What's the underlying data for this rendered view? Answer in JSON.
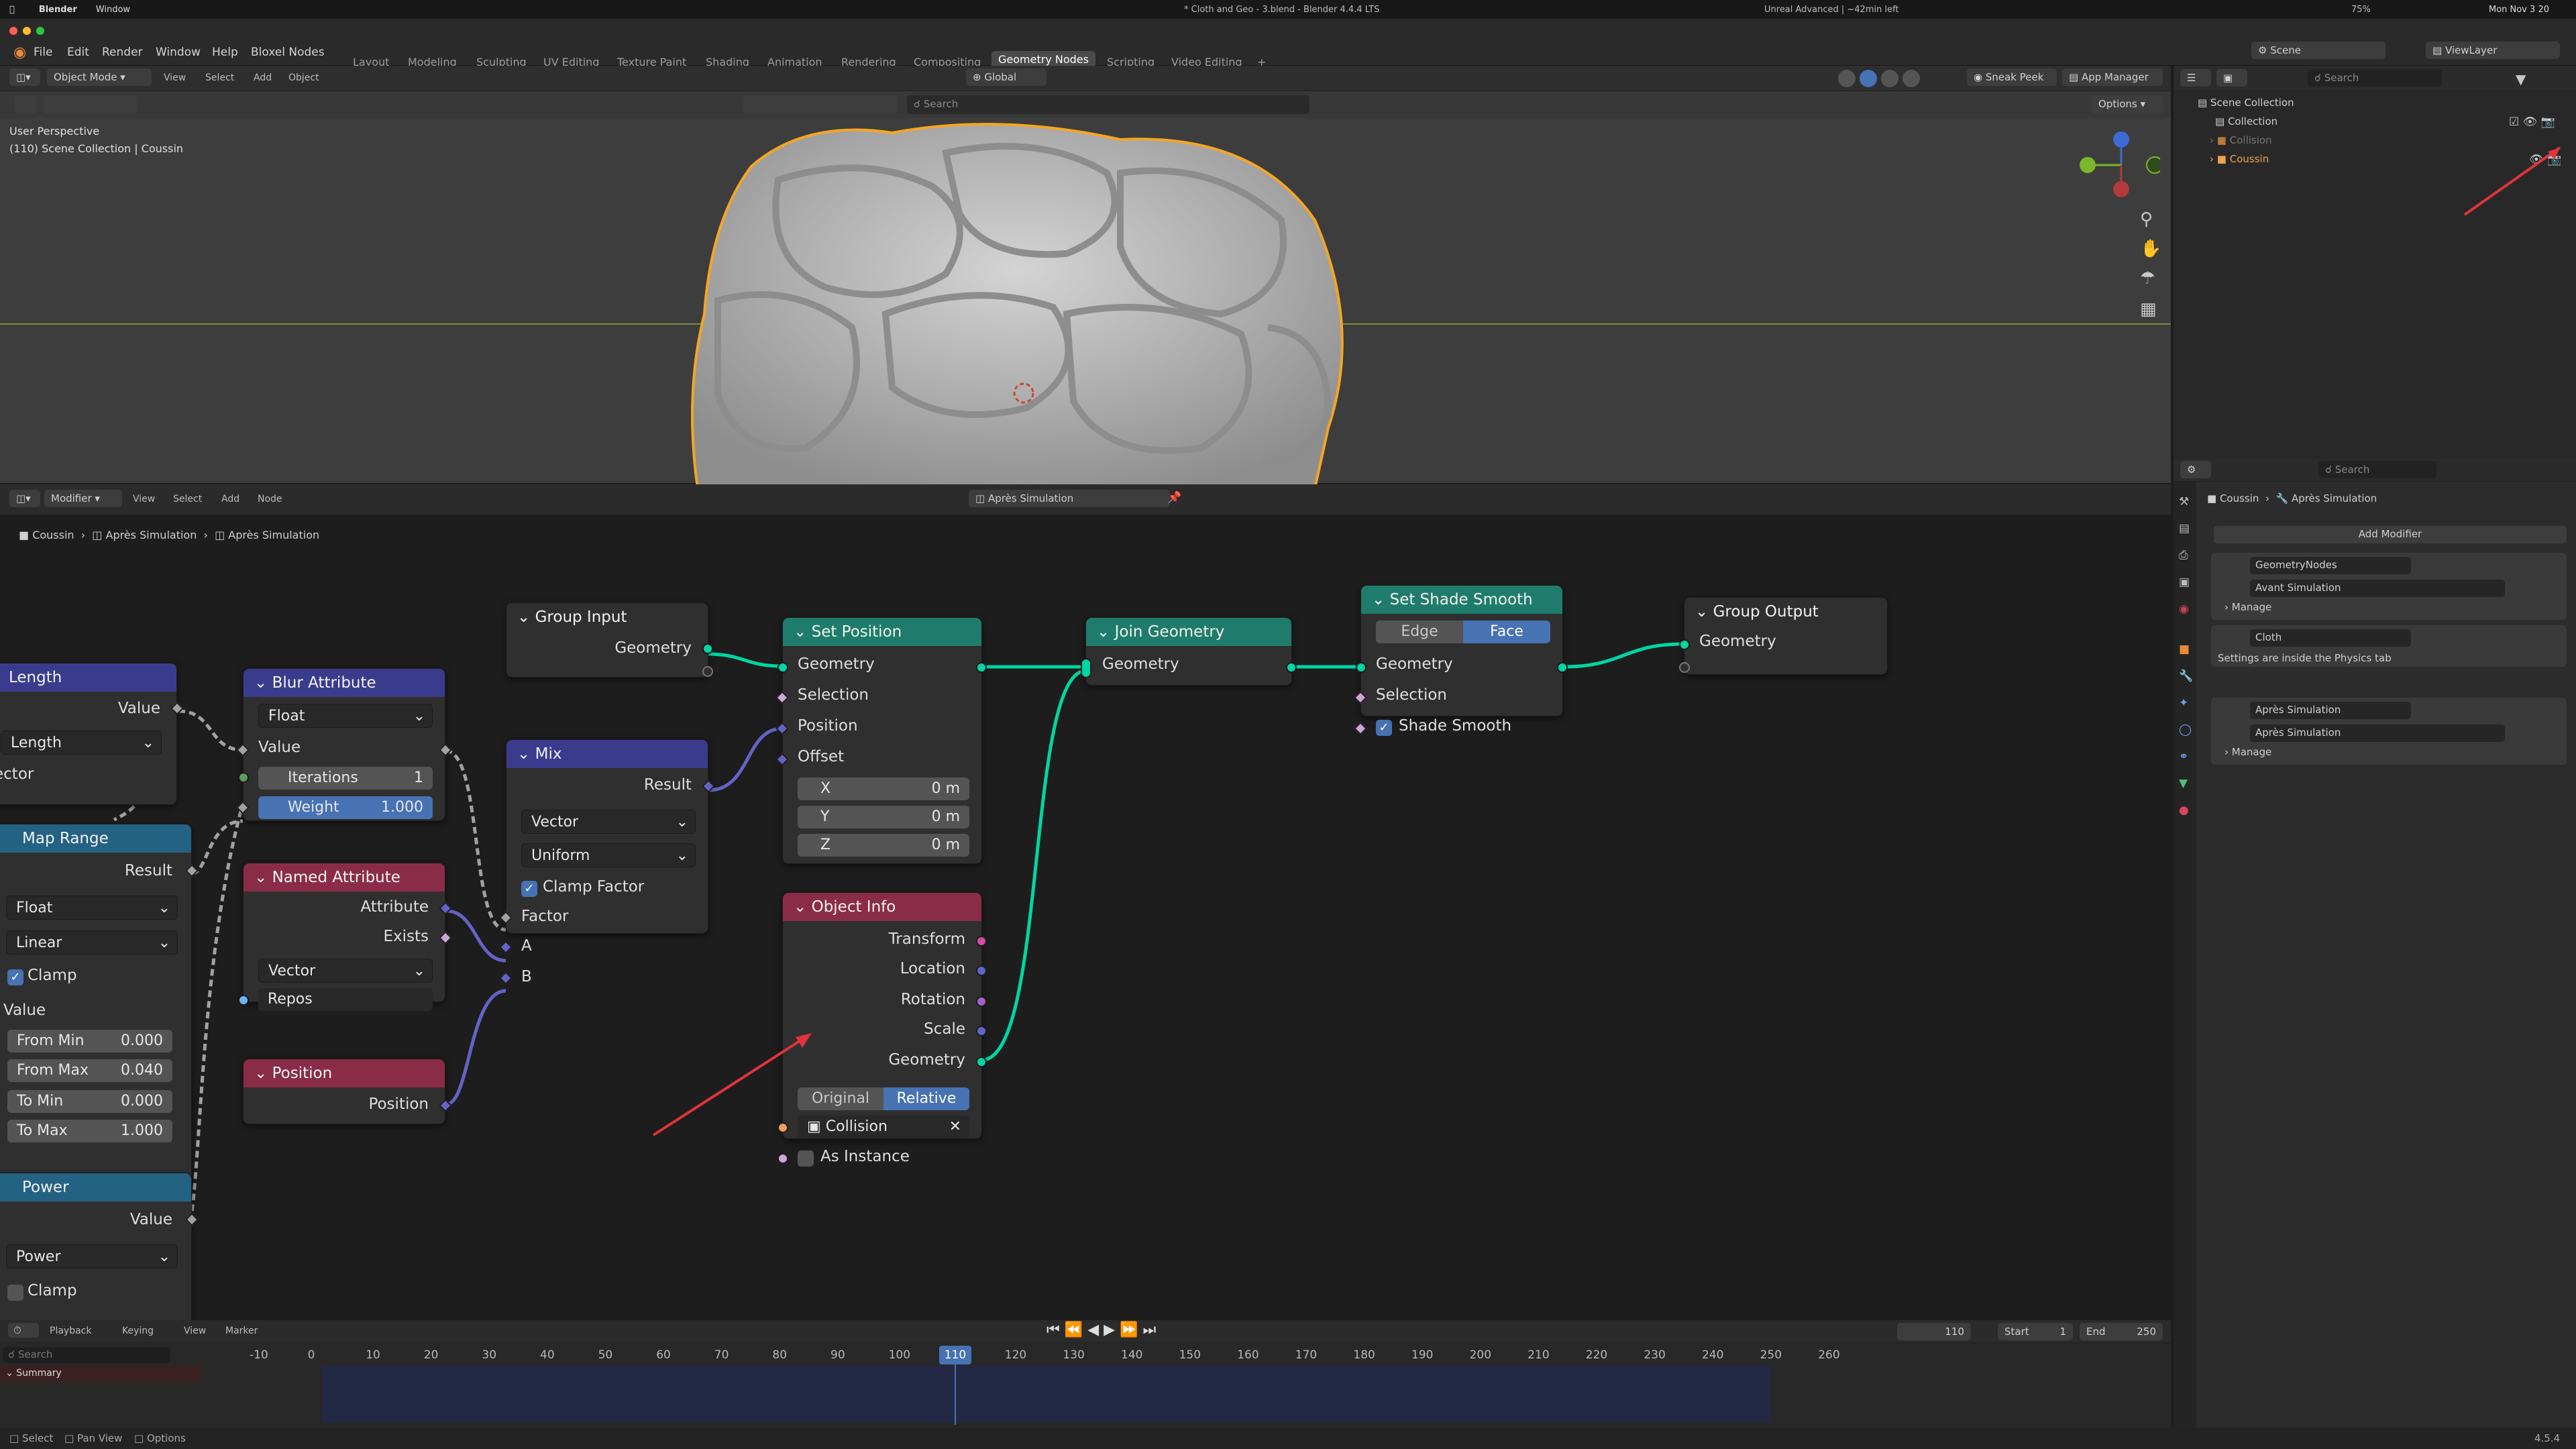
{
  "mac_menu": {
    "app": "Blender",
    "window": "Window",
    "doc_title": "* Cloth and Geo - 3.blend - Blender 4.4.4 LTS",
    "status": "Unreal Advanced | ~42min left",
    "battery": "75%",
    "clock": "Mon Nov 3  20"
  },
  "menu": [
    "File",
    "Edit",
    "Render",
    "Window",
    "Help",
    "Bloxel Nodes"
  ],
  "workspaces": [
    "Layout",
    "Modeling",
    "Sculpting",
    "UV Editing",
    "Texture Paint",
    "Shading",
    "Animation",
    "Rendering",
    "Compositing",
    "Geometry Nodes",
    "Scripting",
    "Video Editing",
    "+"
  ],
  "scene": {
    "scene_label": "Scene",
    "view_layer": "ViewLayer"
  },
  "viewport": {
    "mode": "Object Mode",
    "menus": [
      "View",
      "Select",
      "Add",
      "Object"
    ],
    "orientation": "Global",
    "search_placeholder": "Search",
    "perspective": "User Perspective",
    "collection_info": "(110) Scene Collection | Coussin",
    "sneak_peek": "Sneak Peek",
    "app_manager": "App Manager",
    "options": "Options"
  },
  "outliner": {
    "search_placeholder": "Search",
    "items": [
      "Scene Collection",
      "Collection",
      "Collision",
      "Coussin"
    ]
  },
  "node_editor": {
    "editor": "Modifier",
    "menus": [
      "View",
      "Select",
      "Add",
      "Node"
    ],
    "tree_name": "Après Simulation",
    "breadcrumb": [
      "Coussin",
      "Après Simulation",
      "Après Simulation"
    ]
  },
  "nodes": {
    "length": {
      "title": "Length",
      "value": "Value",
      "dropdown": "Length",
      "socket": "ector"
    },
    "map_range": {
      "title": "Map Range",
      "result": "Result",
      "data_type": "Float",
      "interp": "Linear",
      "clamp": "Clamp",
      "value": "Value",
      "from_min_l": "From Min",
      "from_min": "0.000",
      "from_max_l": "From Max",
      "from_max": "0.040",
      "to_min_l": "To Min",
      "to_min": "0.000",
      "to_max_l": "To Max",
      "to_max": "1.000"
    },
    "power": {
      "title": "Power",
      "value": "Value",
      "dropdown": "Power",
      "clamp": "Clamp"
    },
    "blur": {
      "title": "Blur Attribute",
      "data_type": "Float",
      "value": "Value",
      "iter_l": "Iterations",
      "iter": "1",
      "weight_l": "Weight",
      "weight": "1.000"
    },
    "named_attr": {
      "title": "Named Attribute",
      "attribute": "Attribute",
      "exists": "Exists",
      "data_type": "Vector",
      "name": "Repos"
    },
    "position": {
      "title": "Position",
      "out": "Position"
    },
    "group_input": {
      "title": "Group Input",
      "out": "Geometry"
    },
    "mix": {
      "title": "Mix",
      "result": "Result",
      "data_type": "Vector",
      "mode": "Uniform",
      "clamp": "Clamp Factor",
      "factor": "Factor",
      "a": "A",
      "b": "B"
    },
    "set_position": {
      "title": "Set Position",
      "geometry": "Geometry",
      "selection": "Selection",
      "position": "Position",
      "offset": "Offset",
      "x_l": "X",
      "x": "0 m",
      "y_l": "Y",
      "y": "0 m",
      "z_l": "Z",
      "z": "0 m"
    },
    "object_info": {
      "title": "Object Info",
      "transform": "Transform",
      "location": "Location",
      "rotation": "Rotation",
      "scale": "Scale",
      "geometry": "Geometry",
      "opt_original": "Original",
      "opt_relative": "Relative",
      "object": "Collision",
      "as_instance": "As Instance"
    },
    "join": {
      "title": "Join Geometry",
      "geometry": "Geometry"
    },
    "shade": {
      "title": "Set Shade Smooth",
      "edge": "Edge",
      "face": "Face",
      "geometry": "Geometry",
      "selection": "Selection",
      "shade_smooth": "Shade Smooth"
    },
    "group_output": {
      "title": "Group Output",
      "geometry": "Geometry"
    }
  },
  "properties": {
    "search_placeholder": "Search",
    "crumb_object": "Coussin",
    "crumb_modifier": "Après Simulation",
    "add_modifier": "Add Modifier",
    "modifiers": [
      {
        "name": "GeometryNodes",
        "tree": "Avant Simulation",
        "manage": "Manage"
      },
      {
        "name": "Cloth",
        "note": "Settings are inside the Physics tab"
      },
      {
        "name": "Après Simulation",
        "tree": "Après Simulation",
        "manage": "Manage"
      }
    ]
  },
  "timeline": {
    "menus": [
      "Playback",
      "Keying",
      "View",
      "Marker"
    ],
    "current": "110",
    "start_l": "Start",
    "start": "1",
    "end_l": "End",
    "end": "250",
    "search_placeholder": "Search",
    "summary": "Summary",
    "ticks": [
      "-10",
      "0",
      "10",
      "20",
      "30",
      "40",
      "50",
      "60",
      "70",
      "80",
      "90",
      "100",
      "110",
      "120",
      "130",
      "140",
      "150",
      "160",
      "170",
      "180",
      "190",
      "200",
      "210",
      "220",
      "230",
      "240",
      "250",
      "260"
    ]
  },
  "statusbar": {
    "select": "Select",
    "pan": "Pan View",
    "options": "Options",
    "version": "4.5.4"
  },
  "colors": {
    "accent": "#4772b3",
    "geometry_socket": "#00d6a3",
    "vector_socket": "#6363c7",
    "float_socket": "#a1a1a1",
    "object_socket": "#ed9e5c",
    "bool_socket": "#cca6d6",
    "selection_outline": "#f5a623",
    "annotation": "#e0343a"
  }
}
